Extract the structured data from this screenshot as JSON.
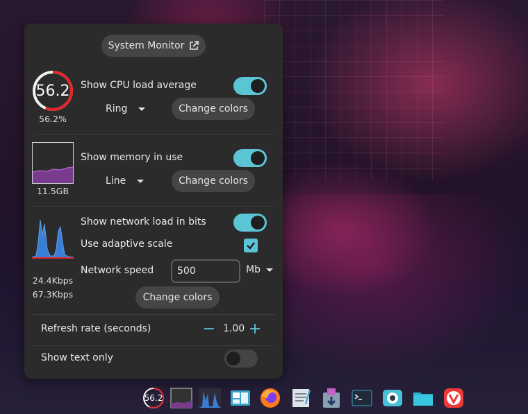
{
  "panel": {
    "system_monitor_label": "System Monitor",
    "cpu": {
      "ring_value": "56.2",
      "percent_text": "56.2%",
      "label": "Show CPU load average",
      "display_mode": "Ring",
      "change_colors_label": "Change colors",
      "enabled": true,
      "load_fraction": 0.562
    },
    "memory": {
      "value_text": "11.5GB",
      "label": "Show memory in use",
      "display_mode": "Line",
      "change_colors_label": "Change colors",
      "enabled": true
    },
    "network": {
      "label": "Show network load in bits",
      "enabled": true,
      "adaptive_label": "Use adaptive scale",
      "adaptive_checked": true,
      "speed_label": "Network speed",
      "speed_value": "500",
      "speed_unit": "Mb",
      "down_text": "24.4Kbps",
      "up_text": "67.3Kbps",
      "change_colors_label": "Change colors"
    },
    "refresh": {
      "label": "Refresh rate (seconds)",
      "value": "1.00",
      "minus_glyph": "−",
      "plus_glyph": "+"
    },
    "text_only": {
      "label": "Show text only",
      "enabled": false
    }
  },
  "taskbar": {
    "cpu_ring_value": "56.2",
    "apps": [
      "cpu-monitor-icon",
      "memory-monitor-icon",
      "network-monitor-icon",
      "window-tiling-icon",
      "firefox-icon",
      "text-editor-icon",
      "software-store-icon",
      "terminal-icon",
      "system-app-icon",
      "files-folder-icon",
      "vivaldi-icon"
    ]
  },
  "colors": {
    "accent": "#5bc5d6",
    "ring_red": "#e3262b",
    "memory_fill": "#7a3b8f",
    "network_fill": "#3b7fd4"
  }
}
